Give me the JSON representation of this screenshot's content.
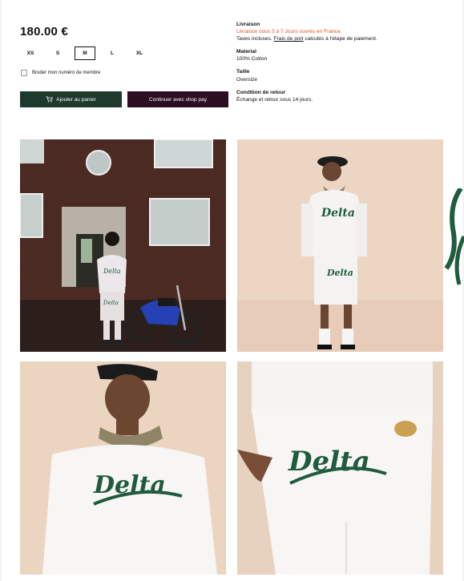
{
  "product": {
    "price": "180.00 €",
    "sizes": [
      "XS",
      "S",
      "M",
      "L",
      "XL"
    ],
    "selected_size": "M",
    "embroider_label": "Broder mon numéro de membre",
    "add_to_cart_label": "Ajouter au panier",
    "shop_pay_label": "Continuer avec shop pay"
  },
  "info": {
    "delivery_title": "Livraison",
    "delivery_note": "Livraison sous 3 à 7 Jours ouvrés en France.",
    "taxes_prefix": "Taxes incluses.",
    "shipping_link": "Frais de port",
    "taxes_suffix": "calculés à l'étape de paiement.",
    "material_title": "Material",
    "material_value": "100% Cotton",
    "size_title": "Taille",
    "size_value": "Oversize",
    "return_title": "Condition de retour",
    "return_value": "Échange et retour sous 14 jours."
  },
  "gallery": {
    "brand_text": "Delta"
  },
  "colors": {
    "accent_orange": "#e4502a",
    "cart_button": "#1e3a2c",
    "shop_pay_button": "#2c0d22",
    "logo_green": "#1f5b3c"
  },
  "icons": {
    "cart": "cart-icon"
  }
}
